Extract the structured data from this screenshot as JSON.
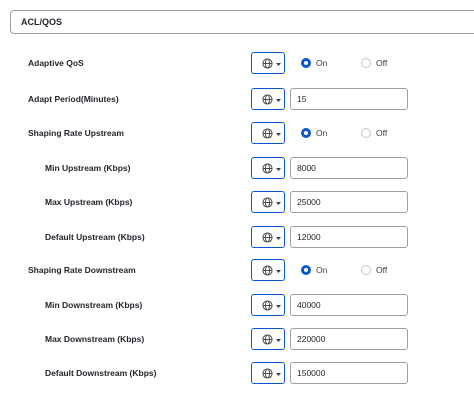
{
  "section": {
    "title": "ACL/QOS"
  },
  "rows": [
    {
      "label": "Adaptive QoS",
      "type": "radio",
      "on": "On",
      "off": "Off",
      "selected": "On"
    },
    {
      "label": "Adapt Period(Minutes)",
      "type": "input",
      "value": "15"
    },
    {
      "label": "Shaping Rate Upstream",
      "type": "radio",
      "on": "On",
      "off": "Off",
      "selected": "On"
    },
    {
      "label": "Min Upstream (Kbps)",
      "type": "input",
      "value": "8000"
    },
    {
      "label": "Max Upstream (Kbps)",
      "type": "input",
      "value": "25000"
    },
    {
      "label": "Default Upstream (Kbps)",
      "type": "input",
      "value": "12000"
    },
    {
      "label": "Shaping Rate Downstream",
      "type": "radio",
      "on": "On",
      "off": "Off",
      "selected": "On"
    },
    {
      "label": "Min Downstream (Kbps)",
      "type": "input",
      "value": "40000"
    },
    {
      "label": "Max Downstream (Kbps)",
      "type": "input",
      "value": "220000"
    },
    {
      "label": "Default Downstream (Kbps)",
      "type": "input",
      "value": "150000"
    }
  ],
  "icons": {
    "scope": "globe-icon",
    "dropdown": "caret-down-icon"
  },
  "colors": {
    "accent": "#0b57d0",
    "border": "#9aa0a6",
    "text": "#1f2329"
  }
}
